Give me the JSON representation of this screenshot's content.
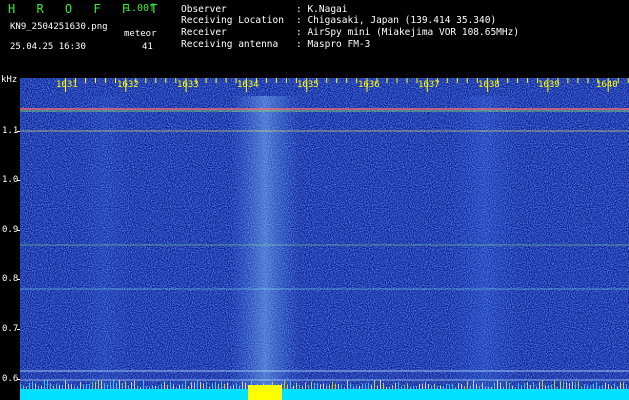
{
  "header": {
    "brand": "H R O F F T",
    "version": "1.00f",
    "filename": "KN9_2504251630.png",
    "timestamp": "25.04.25 16:30",
    "meteor_label": "meteor",
    "meteor_count": "41",
    "info": [
      {
        "key": "Observer",
        "value": ": K.Nagai"
      },
      {
        "key": "Receiving Location",
        "value": ": Chigasaki, Japan (139.414 35.340)"
      },
      {
        "key": "Receiver",
        "value": ": AirSpy mini (Miakejima VOR 108.65MHz)"
      },
      {
        "key": "Receiving antenna",
        "value": ": Maspro FM-3"
      }
    ]
  },
  "axis": {
    "y_unit": "kHz",
    "y_labels": [
      "1.1",
      "1.0",
      "0.9",
      "0.8",
      "0.7",
      "0.6"
    ],
    "x_labels": [
      "1631",
      "1632",
      "1633",
      "1634",
      "1635",
      "1636",
      "1637",
      "1638",
      "1639",
      "1640"
    ]
  },
  "colors": {
    "background": "#000000",
    "spectrum_base": "#0a1c9a",
    "text": "#ffffff",
    "brand": "#33ee33",
    "x_axis": "#ffff00",
    "signal": "#00e0ff",
    "meteor_core": "#ffff00"
  }
}
